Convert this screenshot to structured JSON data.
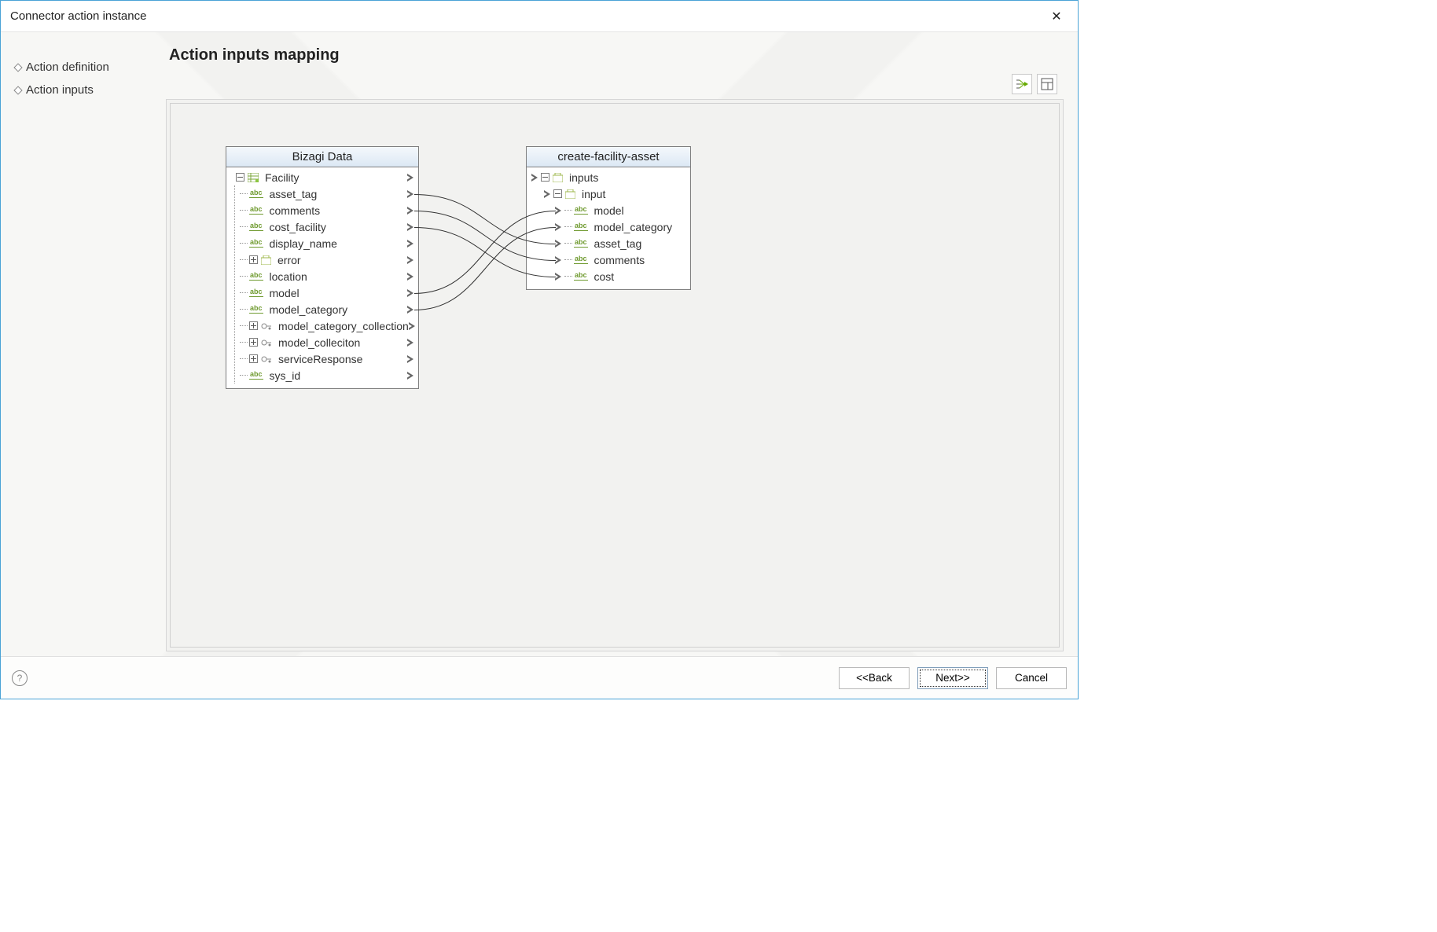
{
  "window": {
    "title": "Connector action instance"
  },
  "sidebar": {
    "items": [
      {
        "label": "Action definition"
      },
      {
        "label": "Action inputs"
      }
    ]
  },
  "main": {
    "heading": "Action inputs mapping"
  },
  "source_panel": {
    "title": "Bizagi Data",
    "root": "Facility",
    "items": [
      {
        "label": "asset_tag",
        "type": "abc",
        "port": true
      },
      {
        "label": "comments",
        "type": "abc",
        "port": true
      },
      {
        "label": "cost_facility",
        "type": "abc",
        "port": true
      },
      {
        "label": "display_name",
        "type": "abc",
        "port": true
      },
      {
        "label": "error",
        "type": "pkg",
        "expander": "plus",
        "port": true
      },
      {
        "label": "location",
        "type": "abc",
        "port": true
      },
      {
        "label": "model",
        "type": "abc",
        "port": true
      },
      {
        "label": "model_category",
        "type": "abc",
        "port": true
      },
      {
        "label": "model_category_collection",
        "type": "key",
        "expander": "plus",
        "port": true
      },
      {
        "label": "model_colleciton",
        "type": "key",
        "expander": "plus",
        "port": true
      },
      {
        "label": "serviceResponse",
        "type": "key",
        "expander": "plus",
        "port": true
      },
      {
        "label": "sys_id",
        "type": "abc",
        "port": true
      }
    ]
  },
  "target_panel": {
    "title": "create-facility-asset",
    "group1": "inputs",
    "group2": "input",
    "items": [
      {
        "label": "model"
      },
      {
        "label": "model_category"
      },
      {
        "label": "asset_tag"
      },
      {
        "label": "comments"
      },
      {
        "label": "cost"
      }
    ]
  },
  "footer": {
    "back_label": "<<Back",
    "next_label": "Next>>",
    "cancel_label": "Cancel"
  }
}
